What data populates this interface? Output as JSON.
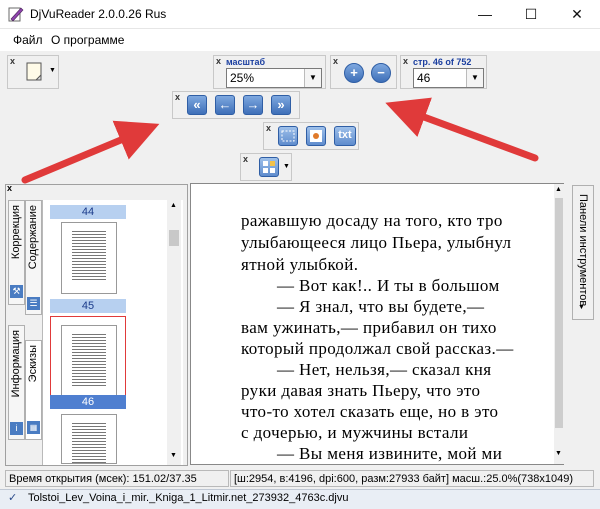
{
  "window": {
    "title": "DjVuReader 2.0.0.26 Rus",
    "minimize_icon": "minimize-icon",
    "maximize_icon": "maximize-icon",
    "close_icon": "close-icon"
  },
  "menu": {
    "items": [
      "Файл",
      "О программе"
    ]
  },
  "toolbar": {
    "zoom_label": "масштаб",
    "zoom_value": "25%",
    "page_label": "стр. 46 of 752",
    "page_value": "46",
    "zoom_in_icon": "zoom-in-icon",
    "zoom_out_icon": "zoom-out-icon",
    "nav_icons": [
      "first-page-icon",
      "prev-page-icon",
      "next-page-icon",
      "last-page-icon"
    ],
    "txt_label": "txt",
    "accent": "#3e6fb8"
  },
  "left_panel": {
    "tabs": [
      "Коррекция",
      "Содержание",
      "Информация",
      "Эскизы"
    ],
    "thumb_pages": [
      "44",
      "45",
      "46"
    ],
    "selected_page": "46",
    "highlight_color": "#e03a3a"
  },
  "right_panel": {
    "tab": "Панели инструментов"
  },
  "document": {
    "lines": [
      "ражавшую досаду на того, кто тро",
      "улыбающееся лицо Пьера, улыбнул",
      "ятной улыбкой.",
      "— Вот как!.. И ты в большом",
      "— Я знал, что вы будете,—",
      "вам ужинать,— прибавил он тихо",
      "который продолжал свой рассказ.—",
      "— Нет, нельзя,— сказал кня",
      "руки давая знать Пьеру, что это",
      "что-то хотел сказать еще, но в это",
      "с дочерью, и мужчины встали",
      "— Вы меня извините, мой ми"
    ]
  },
  "status": {
    "open_time": "Время открытия (мсек): 151.02/37.35",
    "info": "[ш:2954, в:4196, dpi:600, разм:27933 байт] масш.:25.0%(738x1049)"
  },
  "file": {
    "name": "Tolstoi_Lev_Voina_i_mir._Kniga_1_Litmir.net_273932_4763c.djvu"
  },
  "annotation_color": "#e03a3a"
}
